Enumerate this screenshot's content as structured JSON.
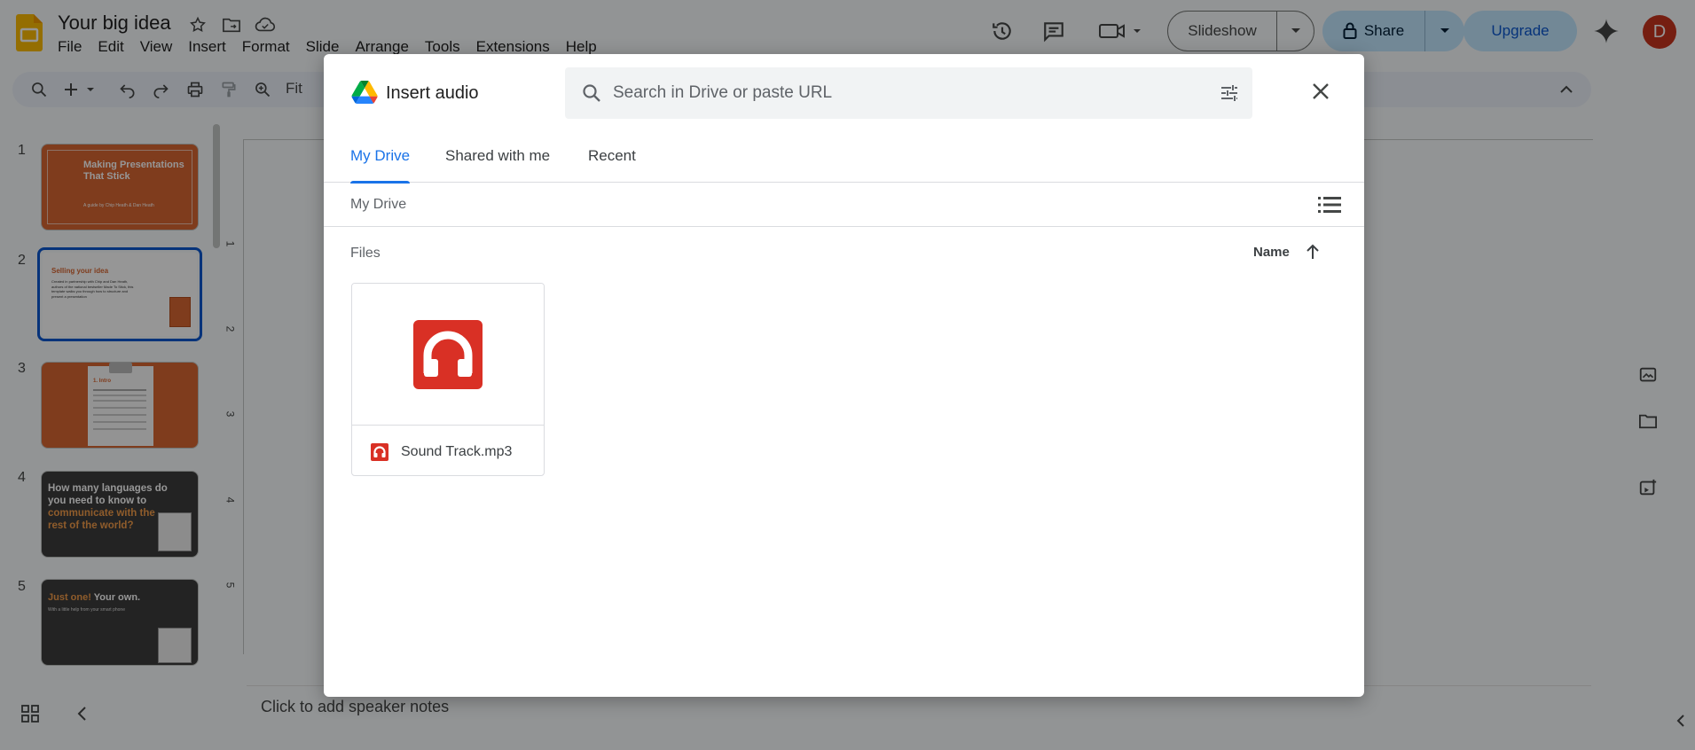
{
  "app": {
    "doc_title": "Your big idea",
    "menu": [
      "File",
      "Edit",
      "View",
      "Insert",
      "Format",
      "Slide",
      "Arrange",
      "Tools",
      "Extensions",
      "Help"
    ]
  },
  "header": {
    "slideshow_label": "Slideshow",
    "share_label": "Share",
    "upgrade_label": "Upgrade",
    "avatar_letter": "D"
  },
  "toolbar": {
    "zoom_label": "Fit"
  },
  "filmstrip": {
    "slides": [
      {
        "num": "1",
        "title": "Making Presentations That Stick",
        "subtitle": "A guide by Chip Heath & Dan Heath"
      },
      {
        "num": "2",
        "title": "Selling your idea",
        "body": "Created in partnership with Chip and Dan Heath, authors of the national bestseller Made To Stick, this template walks you through how to structure and present a presentation"
      },
      {
        "num": "3",
        "title": "1. Intro"
      },
      {
        "num": "4",
        "title": "How many languages do you need to know to",
        "highlight": "communicate with the rest of the world?"
      },
      {
        "num": "5",
        "title_highlight": "Just one!",
        "title": " Your own.",
        "body": "With a little help from your smart phone"
      }
    ]
  },
  "ruler": {
    "marks": [
      "1",
      "2",
      "3",
      "4",
      "5"
    ]
  },
  "notes": {
    "placeholder": "Click to add speaker notes"
  },
  "dialog": {
    "title": "Insert audio",
    "search_placeholder": "Search in Drive or paste URL",
    "tabs": [
      {
        "label": "My Drive",
        "active": true
      },
      {
        "label": "Shared with me",
        "active": false
      },
      {
        "label": "Recent",
        "active": false
      }
    ],
    "breadcrumb": "My Drive",
    "section_label": "Files",
    "sort_label": "Name",
    "files": [
      {
        "name": "Sound Track.mp3",
        "icon": "audio-file-icon"
      }
    ]
  },
  "colors": {
    "accent_blue": "#1a73e8",
    "share_bg": "#c2e7ff",
    "audio_red": "#d93025",
    "slides_yellow": "#fbbc04",
    "avatar_bg": "#c8331e"
  }
}
